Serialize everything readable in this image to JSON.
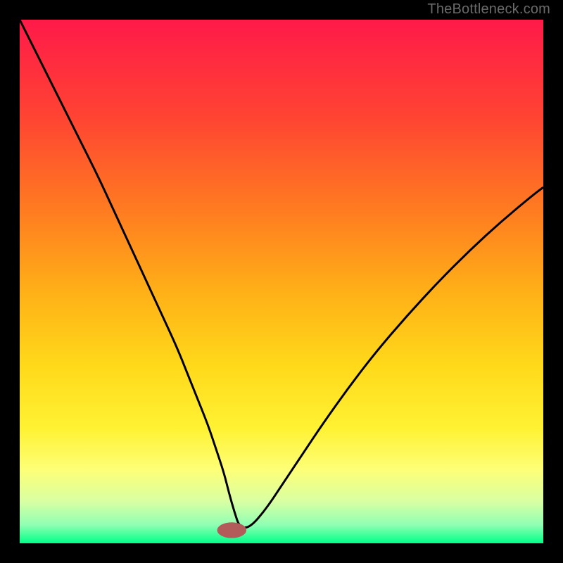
{
  "watermark": "TheBottleneck.com",
  "chart_data": {
    "type": "line",
    "title": "",
    "xlabel": "",
    "ylabel": "",
    "xlim": [
      0,
      100
    ],
    "ylim": [
      0,
      100
    ],
    "grid": false,
    "background_gradient": {
      "type": "vertical",
      "stops": [
        {
          "pos": 0.0,
          "color": "#ff1a49"
        },
        {
          "pos": 0.18,
          "color": "#ff4233"
        },
        {
          "pos": 0.36,
          "color": "#ff7a21"
        },
        {
          "pos": 0.52,
          "color": "#ffb017"
        },
        {
          "pos": 0.66,
          "color": "#ffd91a"
        },
        {
          "pos": 0.78,
          "color": "#fff233"
        },
        {
          "pos": 0.86,
          "color": "#fdff77"
        },
        {
          "pos": 0.92,
          "color": "#d9ffa3"
        },
        {
          "pos": 0.965,
          "color": "#8fffb3"
        },
        {
          "pos": 1.0,
          "color": "#00ff88"
        }
      ]
    },
    "marker": {
      "x": 40.5,
      "y": 2.5,
      "color": "#b35a5a",
      "rx": 2.8,
      "ry": 1.5
    },
    "series": [
      {
        "name": "bottleneck-curve",
        "color": "#000000",
        "x": [
          0,
          3,
          6,
          9,
          12,
          15,
          18,
          21,
          24,
          27,
          30,
          32,
          34,
          36,
          37.5,
          39,
          40,
          41,
          42,
          44,
          47,
          50,
          54,
          58,
          63,
          68,
          74,
          80,
          86,
          92,
          98,
          100
        ],
        "y": [
          100,
          94,
          88,
          82,
          76,
          70,
          63.5,
          57,
          50.5,
          44,
          37.5,
          32.5,
          27.5,
          22.5,
          18,
          13.5,
          9.5,
          6,
          3,
          3,
          6.5,
          11,
          17,
          23,
          30,
          36.5,
          43.5,
          50,
          56,
          61.5,
          66.5,
          68
        ]
      }
    ]
  }
}
